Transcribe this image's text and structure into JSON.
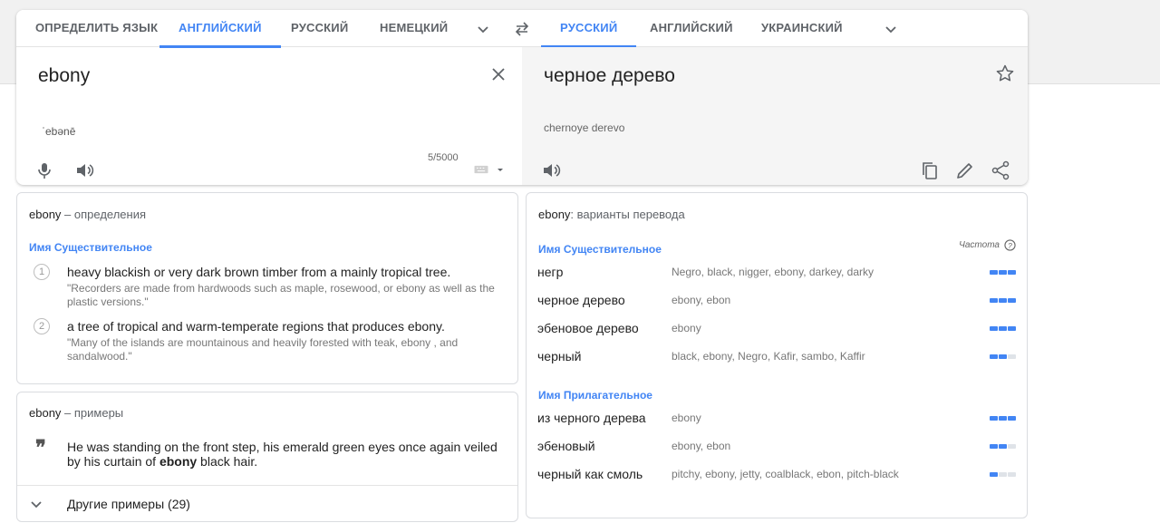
{
  "source_tabs": [
    "ОПРЕДЕЛИТЬ ЯЗЫК",
    "АНГЛИЙСКИЙ",
    "РУССКИЙ",
    "НЕМЕЦКИЙ"
  ],
  "target_tabs": [
    "РУССКИЙ",
    "АНГЛИЙСКИЙ",
    "УКРАИНСКИЙ"
  ],
  "source": {
    "text": "ebony",
    "transliteration": "ˈebənē",
    "counter": "5/5000"
  },
  "target": {
    "text": "черное дерево",
    "transliteration": "chernoye derevo"
  },
  "definitions": {
    "word": "ebony",
    "title_suffix": " – определения",
    "pos": "Имя Существительное",
    "items": [
      {
        "num": "1",
        "text": "heavy blackish or very dark brown timber from a mainly tropical tree.",
        "example": "\"Recorders are made from hardwoods such as maple, rosewood, or ebony as well as the plastic versions.\""
      },
      {
        "num": "2",
        "text": "a tree of tropical and warm-temperate regions that produces ebony.",
        "example": "\"Many of the islands are mountainous and heavily forested with teak, ebony , and sandalwood.\""
      }
    ]
  },
  "examples": {
    "word": "ebony",
    "title_suffix": " – примеры",
    "before": "He was standing on the front step, his emerald green eyes once again veiled by his curtain of ",
    "bold": "ebony",
    "after": " black hair.",
    "more": "Другие примеры (29)"
  },
  "variants": {
    "word": "ebony",
    "title_suffix": ": варианты перевода",
    "frequency_label": "Частота",
    "groups": [
      {
        "pos": "Имя Существительное",
        "rows": [
          {
            "word": "негр",
            "synonyms": "Negro, black, nigger, ebony, darkey, darky",
            "freq": 3
          },
          {
            "word": "черное дерево",
            "synonyms": "ebony, ebon",
            "freq": 3
          },
          {
            "word": "эбеновое дерево",
            "synonyms": "ebony",
            "freq": 3
          },
          {
            "word": "черный",
            "synonyms": "black, ebony, Negro, Kafir, sambo, Kaffir",
            "freq": 2
          }
        ]
      },
      {
        "pos": "Имя Прилагательное",
        "rows": [
          {
            "word": "из черного дерева",
            "synonyms": "ebony",
            "freq": 3
          },
          {
            "word": "эбеновый",
            "synonyms": "ebony, ebon",
            "freq": 2
          },
          {
            "word": "черный как смоль",
            "synonyms": "pitchy, ebony, jetty, coalblack, ebon, pitch-black",
            "freq": 1
          }
        ]
      }
    ]
  },
  "colors": {
    "accent": "#4285f4",
    "bar_off": "#dfe3e8"
  }
}
